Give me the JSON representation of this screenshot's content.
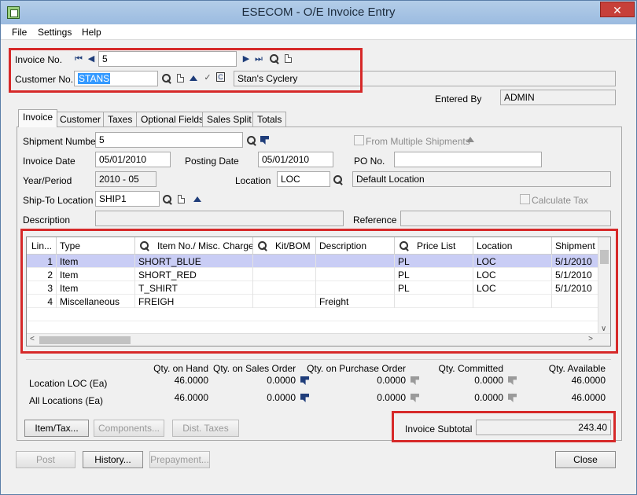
{
  "window": {
    "title": "ESECOM - O/E Invoice Entry",
    "close_symbol": "✕"
  },
  "menu": [
    "File",
    "Settings",
    "Help"
  ],
  "header": {
    "invoice_no_label": "Invoice No.",
    "invoice_no_value": "5",
    "customer_no_label": "Customer No.",
    "customer_no_value": "STANS",
    "customer_name": "Stan's Cyclery",
    "entered_by_label": "Entered By",
    "entered_by_value": "ADMIN"
  },
  "tabs": [
    "Invoice",
    "Customer",
    "Taxes",
    "Optional Fields",
    "Sales Split",
    "Totals"
  ],
  "invoice": {
    "shipment_number_label": "Shipment Number",
    "shipment_number_value": "5",
    "from_multiple_label": "From Multiple Shipments",
    "invoice_date_label": "Invoice Date",
    "invoice_date_value": "05/01/2010",
    "posting_date_label": "Posting Date",
    "posting_date_value": "05/01/2010",
    "po_no_label": "PO No.",
    "po_no_value": "",
    "year_period_label": "Year/Period",
    "year_period_value": "2010 - 05",
    "location_label": "Location",
    "location_value": "LOC",
    "location_desc": "Default Location",
    "ship_to_label": "Ship-To Location",
    "ship_to_value": "SHIP1",
    "calc_tax_label": "Calculate Tax",
    "description_label": "Description",
    "description_value": "",
    "reference_label": "Reference",
    "reference_value": ""
  },
  "grid": {
    "columns": [
      "Lin...",
      "Type",
      "Item No./ Misc. Charge",
      "Kit/BOM",
      "Description",
      "Price List",
      "Location",
      "Shipment D"
    ],
    "rows": [
      {
        "line": "1",
        "type": "Item",
        "item": "SHORT_BLUE",
        "kit": "",
        "desc": "",
        "price_list": "PL",
        "location": "LOC",
        "ship_date": "5/1/2010"
      },
      {
        "line": "2",
        "type": "Item",
        "item": "SHORT_RED",
        "kit": "",
        "desc": "",
        "price_list": "PL",
        "location": "LOC",
        "ship_date": "5/1/2010"
      },
      {
        "line": "3",
        "type": "Item",
        "item": "T_SHIRT",
        "kit": "",
        "desc": "",
        "price_list": "PL",
        "location": "LOC",
        "ship_date": "5/1/2010"
      },
      {
        "line": "4",
        "type": "Miscellaneous",
        "item": "FREIGH",
        "kit": "",
        "desc": "Freight",
        "price_list": "",
        "location": "",
        "ship_date": ""
      }
    ]
  },
  "qty": {
    "headers": [
      "Qty. on Hand",
      "Qty. on Sales Order",
      "Qty. on Purchase Order",
      "Qty. Committed",
      "Qty. Available"
    ],
    "rows": [
      {
        "label": "Location  LOC (Ea)",
        "values": [
          "46.0000",
          "0.0000",
          "0.0000",
          "0.0000",
          "46.0000"
        ]
      },
      {
        "label": "All Locations (Ea)",
        "values": [
          "46.0000",
          "0.0000",
          "0.0000",
          "0.0000",
          "46.0000"
        ]
      }
    ]
  },
  "buttons": {
    "item_tax": "Item/Tax...",
    "components": "Components...",
    "dist_taxes": "Dist. Taxes",
    "post": "Post",
    "history": "History...",
    "prepayment": "Prepayment...",
    "close": "Close"
  },
  "subtotal": {
    "label": "Invoice Subtotal",
    "value": "243.40"
  },
  "colors": {
    "highlight_red": "#d62929",
    "selected_row": "#c9cdf5",
    "selection_blue": "#3399ff"
  }
}
